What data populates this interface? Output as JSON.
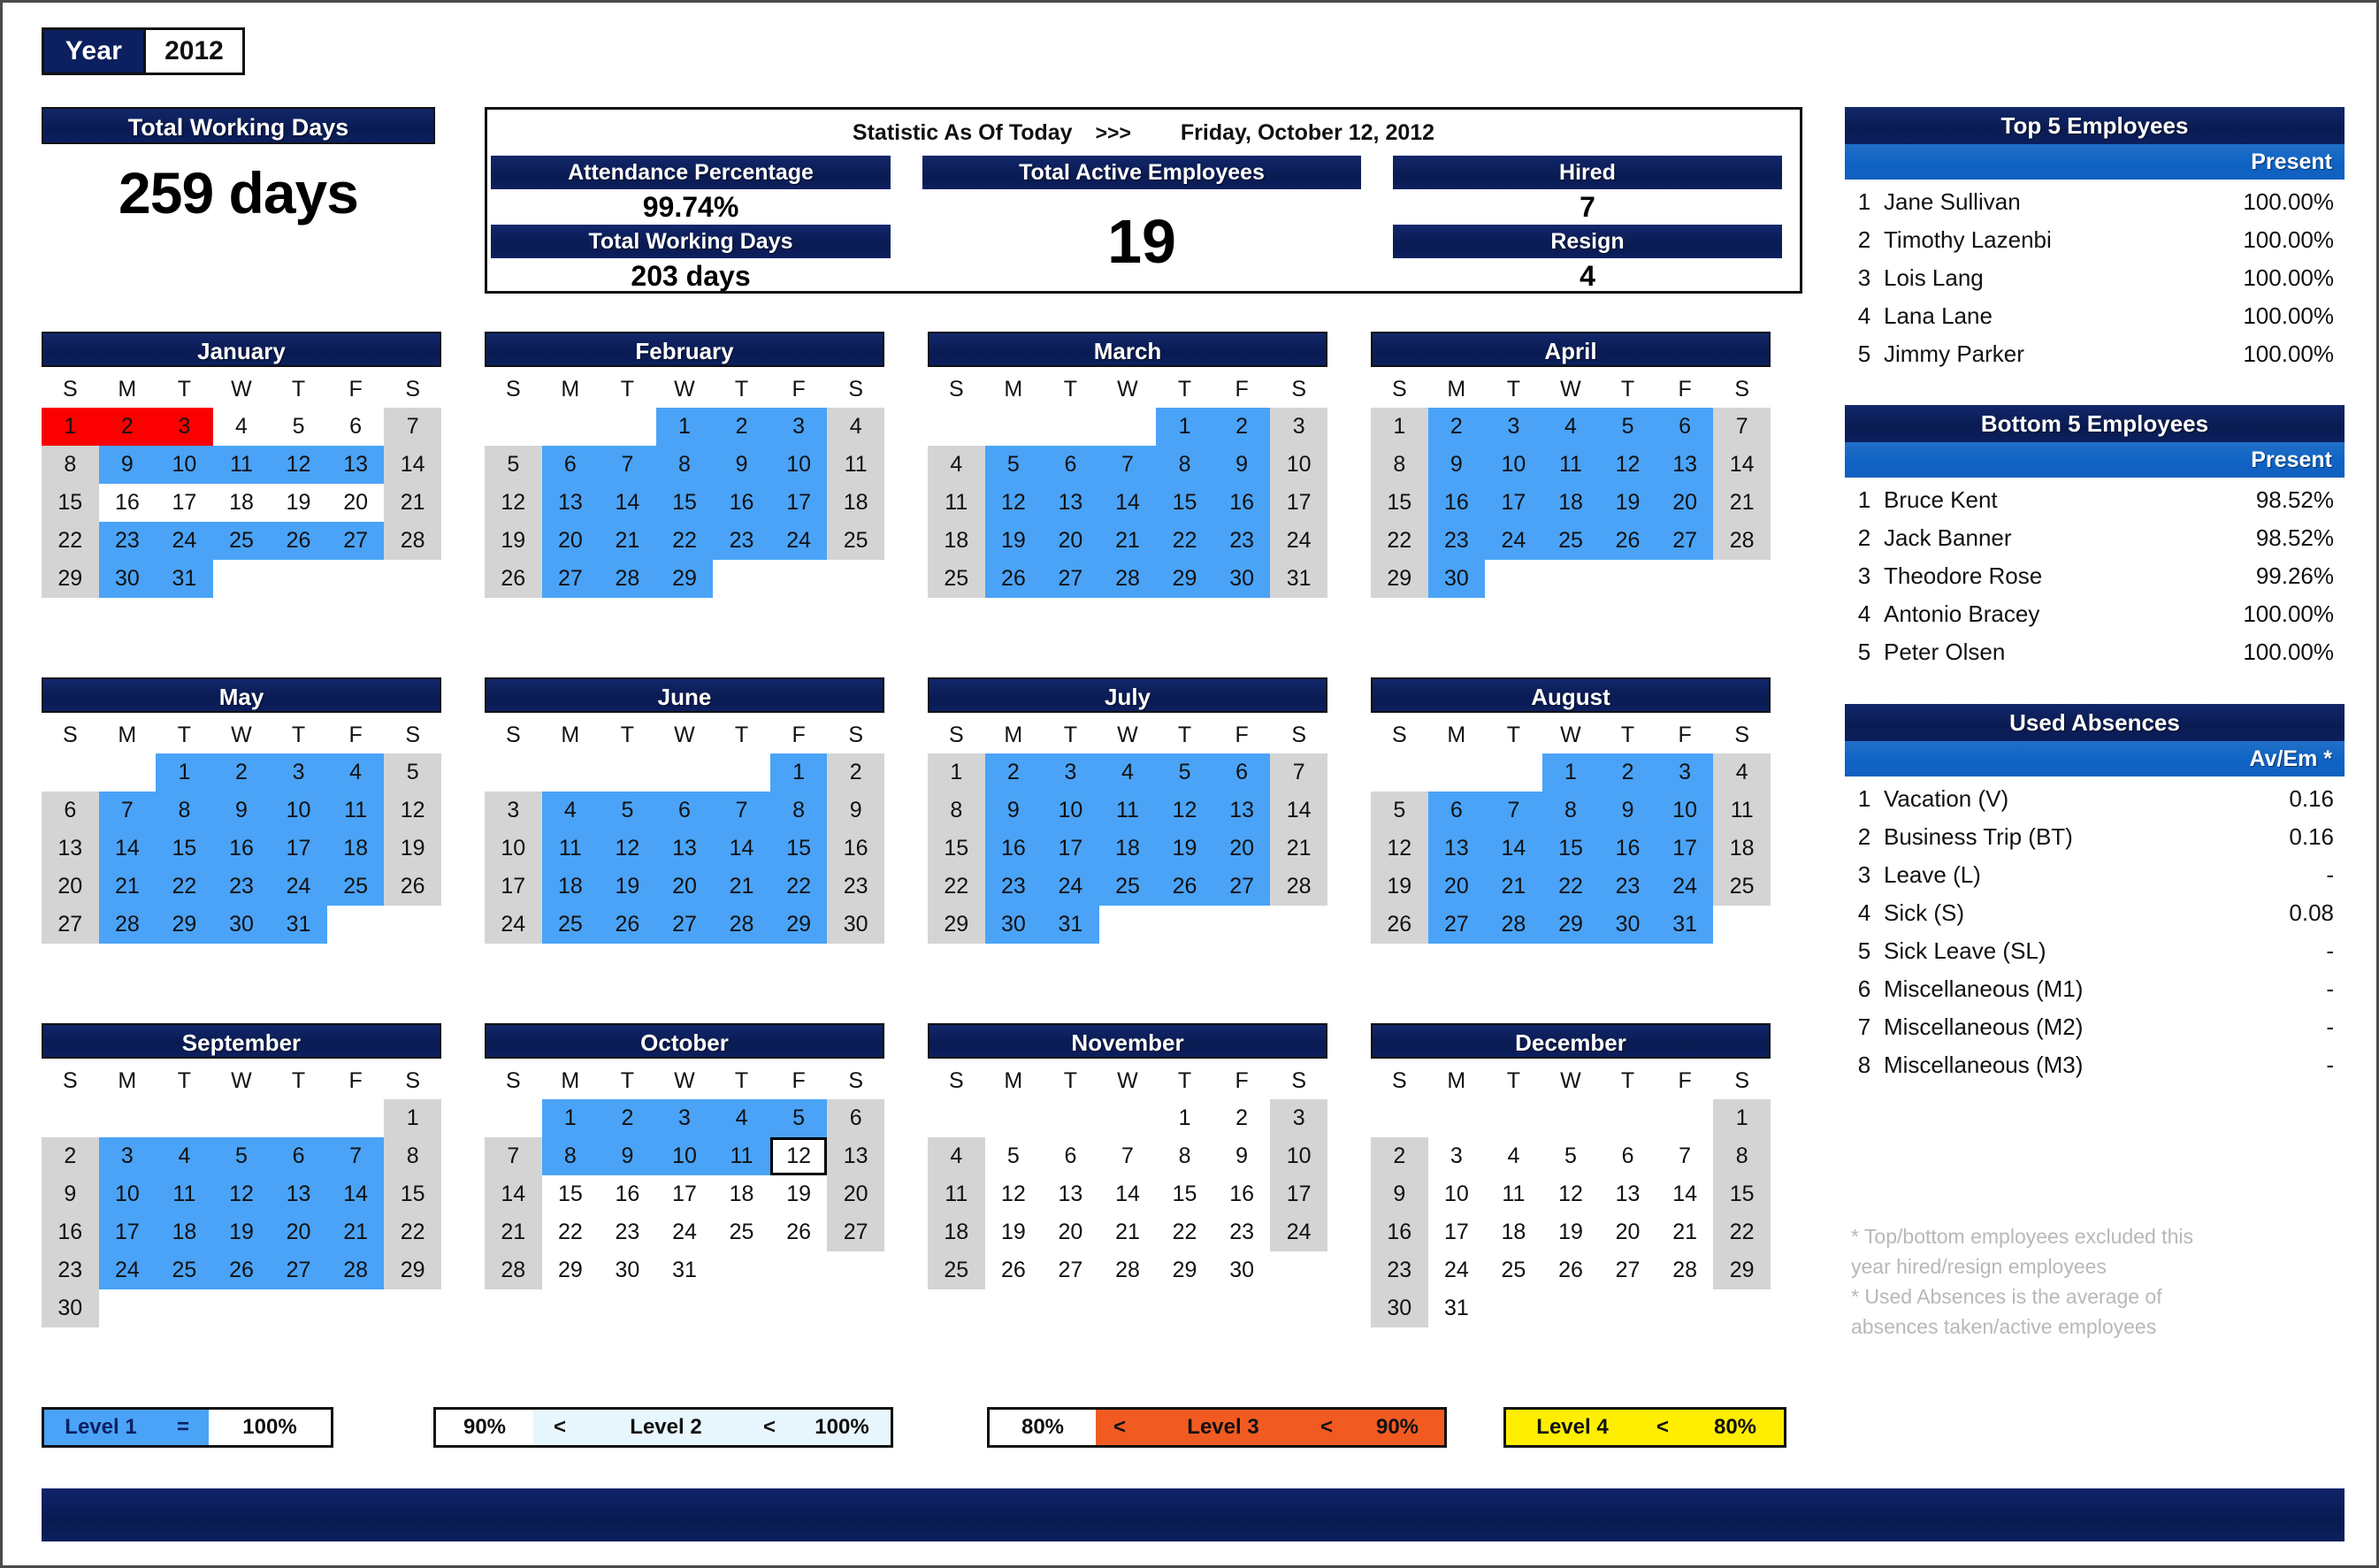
{
  "year_selector": {
    "label": "Year",
    "value": "2012"
  },
  "total_working_days": {
    "title": "Total Working Days",
    "value": "259 days"
  },
  "statistics": {
    "as_of_label": "Statistic As Of Today",
    "arrows": ">>>",
    "date": "Friday, October 12, 2012",
    "attendance_percentage_label": "Attendance Percentage",
    "attendance_percentage_value": "99.74%",
    "total_working_days_label": "Total Working Days",
    "total_working_days_value": "203 days",
    "total_active_employees_label": "Total Active Employees",
    "total_active_employees_value": "19",
    "hired_label": "Hired",
    "hired_value": "7",
    "resign_label": "Resign",
    "resign_value": "4"
  },
  "top5": {
    "title": "Top 5 Employees",
    "column": "Present",
    "rows": [
      {
        "idx": "1",
        "name": "Jane Sullivan",
        "value": "100.00%"
      },
      {
        "idx": "2",
        "name": "Timothy Lazenbi",
        "value": "100.00%"
      },
      {
        "idx": "3",
        "name": "Lois Lang",
        "value": "100.00%"
      },
      {
        "idx": "4",
        "name": "Lana Lane",
        "value": "100.00%"
      },
      {
        "idx": "5",
        "name": "Jimmy Parker",
        "value": "100.00%"
      }
    ]
  },
  "bottom5": {
    "title": "Bottom 5 Employees",
    "column": "Present",
    "rows": [
      {
        "idx": "1",
        "name": "Bruce Kent",
        "value": "98.52%"
      },
      {
        "idx": "2",
        "name": "Jack Banner",
        "value": "98.52%"
      },
      {
        "idx": "3",
        "name": "Theodore Rose",
        "value": "99.26%"
      },
      {
        "idx": "4",
        "name": "Antonio Bracey",
        "value": "100.00%"
      },
      {
        "idx": "5",
        "name": "Peter Olsen",
        "value": "100.00%"
      }
    ]
  },
  "used_absences": {
    "title": "Used Absences",
    "column": "Av/Em *",
    "rows": [
      {
        "idx": "1",
        "name": "Vacation (V)",
        "value": "0.16"
      },
      {
        "idx": "2",
        "name": "Business Trip (BT)",
        "value": "0.16"
      },
      {
        "idx": "3",
        "name": "Leave (L)",
        "value": "-"
      },
      {
        "idx": "4",
        "name": "Sick (S)",
        "value": "0.08"
      },
      {
        "idx": "5",
        "name": "Sick Leave (SL)",
        "value": "-"
      },
      {
        "idx": "6",
        "name": "Miscellaneous (M1)",
        "value": "-"
      },
      {
        "idx": "7",
        "name": "Miscellaneous (M2)",
        "value": "-"
      },
      {
        "idx": "8",
        "name": "Miscellaneous (M3)",
        "value": "-"
      }
    ]
  },
  "footnote": "* Top/bottom employees excluded this year hired/resign employees\n* Used Absences is the average of absences taken/active employees",
  "footnote_lines": [
    "* Top/bottom employees excluded this",
    "year hired/resign employees",
    "* Used Absences is the average of",
    "absences taken/active employees"
  ],
  "weekday_headers": [
    "S",
    "M",
    "T",
    "W",
    "T",
    "F",
    "S"
  ],
  "colors": {
    "navy": "#0c1f5e",
    "blue_work": "#4aa3f7",
    "grey_weekend": "#d4d4d4",
    "red_holiday": "#fb0000",
    "subhead_blue": "#1060bf",
    "level3_orange": "#f15b22",
    "level4_yellow": "#ffee00",
    "level2_pale": "#e8f6fd"
  },
  "legend": [
    {
      "id": "level1",
      "segments": [
        {
          "text": "Level 1",
          "color": "#4aa3f7"
        },
        {
          "text": "=",
          "color": "#4aa3f7"
        },
        {
          "text": "100%",
          "color": "#ffffff"
        }
      ]
    },
    {
      "id": "level2",
      "segments": [
        {
          "text": "90%",
          "color": "#ffffff"
        },
        {
          "text": "<",
          "color": "#e8f6fd"
        },
        {
          "text": "Level 2",
          "color": "#e8f6fd"
        },
        {
          "text": "<",
          "color": "#e8f6fd"
        },
        {
          "text": "100%",
          "color": "#e8f6fd"
        }
      ]
    },
    {
      "id": "level3",
      "segments": [
        {
          "text": "80%",
          "color": "#ffffff"
        },
        {
          "text": "<",
          "color": "#f15b22"
        },
        {
          "text": "Level 3",
          "color": "#f15b22"
        },
        {
          "text": "<",
          "color": "#f15b22"
        },
        {
          "text": "90%",
          "color": "#f15b22"
        }
      ]
    },
    {
      "id": "level4",
      "segments": [
        {
          "text": "Level 4",
          "color": "#ffee00"
        },
        {
          "text": "<",
          "color": "#ffee00"
        },
        {
          "text": "80%",
          "color": "#ffee00"
        }
      ]
    }
  ],
  "months": [
    {
      "name": "January",
      "first_weekday": 0,
      "days": 31,
      "classes": {
        "1": "hol",
        "2": "hol",
        "3": "hol",
        "7": "wknd",
        "8": "wknd",
        "9": "work",
        "10": "work",
        "11": "work",
        "12": "work",
        "13": "work",
        "14": "wknd",
        "15": "wknd",
        "21": "wknd",
        "22": "wknd",
        "23": "work",
        "24": "work",
        "25": "work",
        "26": "work",
        "27": "work",
        "28": "wknd",
        "29": "wknd",
        "30": "work",
        "31": "work"
      }
    },
    {
      "name": "February",
      "first_weekday": 3,
      "days": 29,
      "classes": {
        "1": "work",
        "2": "work",
        "3": "work",
        "4": "wknd",
        "5": "wknd",
        "6": "work",
        "7": "work",
        "8": "work",
        "9": "work",
        "10": "work",
        "11": "wknd",
        "12": "wknd",
        "13": "work",
        "14": "work",
        "15": "work",
        "16": "work",
        "17": "work",
        "18": "wknd",
        "19": "wknd",
        "20": "work",
        "21": "work",
        "22": "work",
        "23": "work",
        "24": "work",
        "25": "wknd",
        "26": "wknd",
        "27": "work",
        "28": "work",
        "29": "work"
      }
    },
    {
      "name": "March",
      "first_weekday": 4,
      "days": 31,
      "classes": {
        "1": "work",
        "2": "work",
        "3": "wknd",
        "4": "wknd",
        "5": "work",
        "6": "work",
        "7": "work",
        "8": "work",
        "9": "work",
        "10": "wknd",
        "11": "wknd",
        "12": "work",
        "13": "work",
        "14": "work",
        "15": "work",
        "16": "work",
        "17": "wknd",
        "18": "wknd",
        "19": "work",
        "20": "work",
        "21": "work",
        "22": "work",
        "23": "work",
        "24": "wknd",
        "25": "wknd",
        "26": "work",
        "27": "work",
        "28": "work",
        "29": "work",
        "30": "work",
        "31": "wknd"
      }
    },
    {
      "name": "April",
      "first_weekday": 0,
      "days": 30,
      "classes": {
        "1": "wknd",
        "2": "work",
        "3": "work",
        "4": "work",
        "5": "work",
        "6": "work",
        "7": "wknd",
        "8": "wknd",
        "9": "work",
        "10": "work",
        "11": "work",
        "12": "work",
        "13": "work",
        "14": "wknd",
        "15": "wknd",
        "16": "work",
        "17": "work",
        "18": "work",
        "19": "work",
        "20": "work",
        "21": "wknd",
        "22": "wknd",
        "23": "work",
        "24": "work",
        "25": "work",
        "26": "work",
        "27": "work",
        "28": "wknd",
        "29": "wknd",
        "30": "work"
      }
    },
    {
      "name": "May",
      "first_weekday": 2,
      "days": 31,
      "classes": {
        "1": "work",
        "2": "work",
        "3": "work",
        "4": "work",
        "5": "wknd",
        "6": "wknd",
        "7": "work",
        "8": "work",
        "9": "work",
        "10": "work",
        "11": "work",
        "12": "wknd",
        "13": "wknd",
        "14": "work",
        "15": "work",
        "16": "work",
        "17": "work",
        "18": "work",
        "19": "wknd",
        "20": "wknd",
        "21": "work",
        "22": "work",
        "23": "work",
        "24": "work",
        "25": "work",
        "26": "wknd",
        "27": "wknd",
        "28": "work",
        "29": "work",
        "30": "work",
        "31": "work"
      }
    },
    {
      "name": "June",
      "first_weekday": 5,
      "days": 30,
      "classes": {
        "1": "work",
        "2": "wknd",
        "3": "wknd",
        "4": "work",
        "5": "work",
        "6": "work",
        "7": "work",
        "8": "work",
        "9": "wknd",
        "10": "wknd",
        "11": "work",
        "12": "work",
        "13": "work",
        "14": "work",
        "15": "work",
        "16": "wknd",
        "17": "wknd",
        "18": "work",
        "19": "work",
        "20": "work",
        "21": "work",
        "22": "work",
        "23": "wknd",
        "24": "wknd",
        "25": "work",
        "26": "work",
        "27": "work",
        "28": "work",
        "29": "work",
        "30": "wknd"
      }
    },
    {
      "name": "July",
      "first_weekday": 0,
      "days": 31,
      "classes": {
        "1": "wknd",
        "2": "work",
        "3": "work",
        "4": "work",
        "5": "work",
        "6": "work",
        "7": "wknd",
        "8": "wknd",
        "9": "work",
        "10": "work",
        "11": "work",
        "12": "work",
        "13": "work",
        "14": "wknd",
        "15": "wknd",
        "16": "work",
        "17": "work",
        "18": "work",
        "19": "work",
        "20": "work",
        "21": "wknd",
        "22": "wknd",
        "23": "work",
        "24": "work",
        "25": "work",
        "26": "work",
        "27": "work",
        "28": "wknd",
        "29": "wknd",
        "30": "work",
        "31": "work"
      }
    },
    {
      "name": "August",
      "first_weekday": 3,
      "days": 31,
      "classes": {
        "1": "work",
        "2": "work",
        "3": "work",
        "4": "wknd",
        "5": "wknd",
        "6": "work",
        "7": "work",
        "8": "work",
        "9": "work",
        "10": "work",
        "11": "wknd",
        "12": "wknd",
        "13": "work",
        "14": "work",
        "15": "work",
        "16": "work",
        "17": "work",
        "18": "wknd",
        "19": "wknd",
        "20": "work",
        "21": "work",
        "22": "work",
        "23": "work",
        "24": "work",
        "25": "wknd",
        "26": "wknd",
        "27": "work",
        "28": "work",
        "29": "work",
        "30": "work",
        "31": "work"
      }
    },
    {
      "name": "September",
      "first_weekday": 6,
      "days": 30,
      "classes": {
        "1": "wknd",
        "2": "wknd",
        "3": "work",
        "4": "work",
        "5": "work",
        "6": "work",
        "7": "work",
        "8": "wknd",
        "9": "wknd",
        "10": "work",
        "11": "work",
        "12": "work",
        "13": "work",
        "14": "work",
        "15": "wknd",
        "16": "wknd",
        "17": "work",
        "18": "work",
        "19": "work",
        "20": "work",
        "21": "work",
        "22": "wknd",
        "23": "wknd",
        "24": "work",
        "25": "work",
        "26": "work",
        "27": "work",
        "28": "work",
        "29": "wknd",
        "30": "wknd"
      }
    },
    {
      "name": "October",
      "first_weekday": 1,
      "days": 31,
      "classes": {
        "1": "work",
        "2": "work",
        "3": "work",
        "4": "work",
        "5": "work",
        "6": "wknd",
        "7": "wknd",
        "8": "work",
        "9": "work",
        "10": "work",
        "11": "work",
        "12": "today",
        "13": "wknd",
        "14": "wknd",
        "20": "wknd",
        "21": "wknd",
        "27": "wknd",
        "28": "wknd"
      }
    },
    {
      "name": "November",
      "first_weekday": 4,
      "days": 30,
      "classes": {
        "3": "wknd",
        "4": "wknd",
        "10": "wknd",
        "11": "wknd",
        "17": "wknd",
        "18": "wknd",
        "24": "wknd",
        "25": "wknd"
      }
    },
    {
      "name": "December",
      "first_weekday": 6,
      "days": 31,
      "classes": {
        "1": "wknd",
        "2": "wknd",
        "8": "wknd",
        "9": "wknd",
        "15": "wknd",
        "16": "wknd",
        "22": "wknd",
        "23": "wknd",
        "29": "wknd",
        "30": "wknd"
      }
    }
  ],
  "bottom_bar": {
    "color": "#0b1f5c"
  }
}
